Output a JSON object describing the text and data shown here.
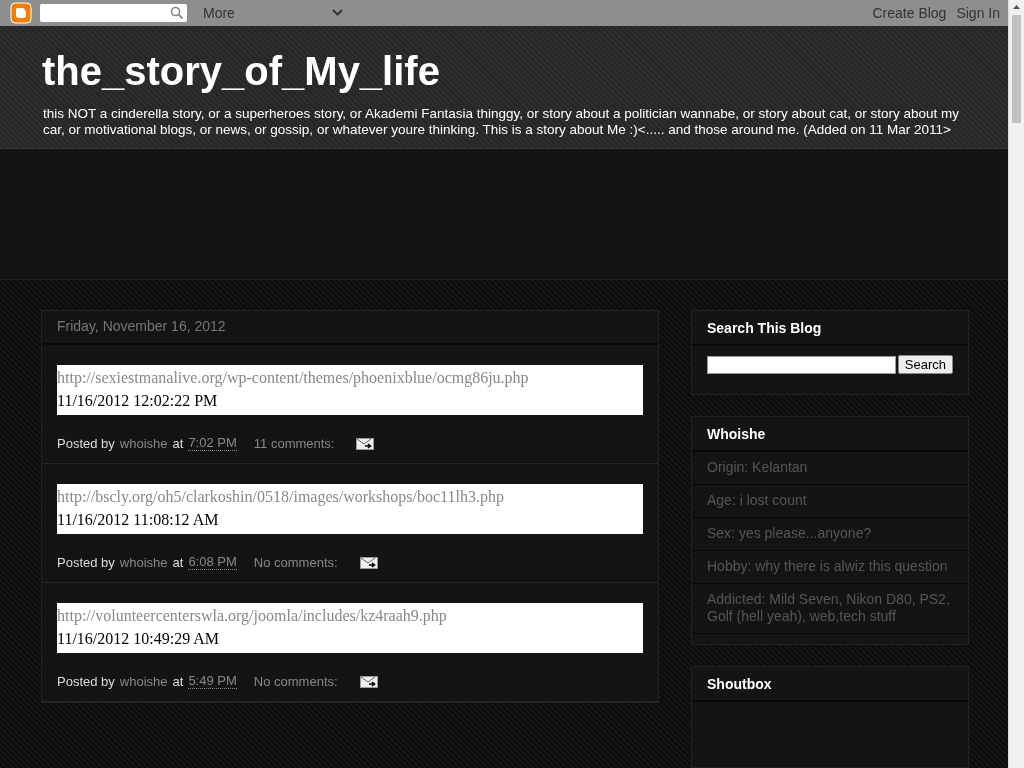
{
  "navbar": {
    "more_label": "More",
    "links": [
      "Create Blog",
      "Sign In"
    ]
  },
  "header": {
    "title": "the_story_of_My_life",
    "description": "this NOT a cinderella story, or a superheroes story, or Akademi Fantasia thinggy, or story about a politician wannabe, or story about cat, or story about my car, or motivational blogs, or news, or gossip, or whatever youre thinking. This is a story about Me :)<..... and those around me. (Added on 11 Mar 2011>"
  },
  "date_header": "Friday, November 16, 2012",
  "posts": [
    {
      "url": "http://sexiestmanalive.org/wp-content/themes/phoenixblue/ocmg86ju.php",
      "timestamp": "11/16/2012 12:02:22 PM",
      "posted_by": "Posted by",
      "author": "whoishe",
      "at": "at",
      "time": "7:02 PM",
      "comments": "11 comments:"
    },
    {
      "url": "http://bscly.org/oh5/clarkoshin/0518/images/workshops/boc11lh3.php",
      "timestamp": "11/16/2012 11:08:12 AM",
      "posted_by": "Posted by",
      "author": "whoishe",
      "at": "at",
      "time": "6:08 PM",
      "comments": "No comments:"
    },
    {
      "url": "http://volunteercenterswla.org/joomla/includes/kz4raah9.php",
      "timestamp": "11/16/2012 10:49:29 AM",
      "posted_by": "Posted by",
      "author": "whoishe",
      "at": "at",
      "time": "5:49 PM",
      "comments": "No comments:"
    }
  ],
  "sidebar": {
    "search_widget": {
      "title": "Search This Blog",
      "button": "Search"
    },
    "profile_widget": {
      "title": "Whoishe",
      "items": [
        "Origin: Kelantan",
        "Age: i lost count",
        "Sex: yes please...anyone?",
        "Hobby: why there is alwiz this question",
        "Addicted: Mild Seven, Nikon D80, PS2, Golf (hell yeah), web,tech stuff"
      ]
    },
    "shoutbox_widget": {
      "title": "Shoutbox"
    }
  }
}
